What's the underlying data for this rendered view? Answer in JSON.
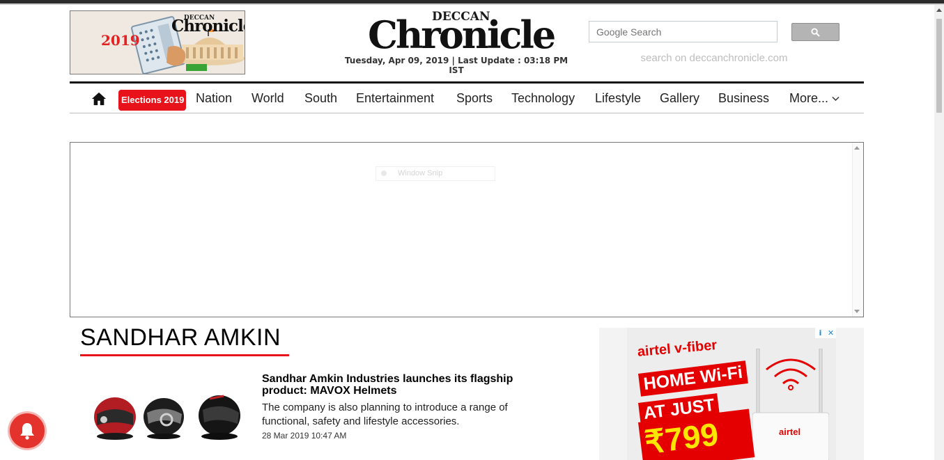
{
  "header": {
    "election_logo": {
      "year": "2019",
      "brand_small_top": "DECCAN",
      "brand_small": "Chronicle"
    },
    "brand": {
      "top": "DECCAN",
      "name": "Chronicle"
    },
    "dateline": "Tuesday, Apr 09, 2019 | Last Update : 03:18 PM IST",
    "search": {
      "placeholder": "Google Search",
      "hint": "search on deccanchronicle.com",
      "button_icon": "search-icon"
    }
  },
  "nav": {
    "home_icon": "home-icon",
    "highlight": "Elections 2019",
    "items": [
      "Nation",
      "World",
      "South",
      "Entertainment",
      "Sports",
      "Technology",
      "Lifestyle",
      "Gallery",
      "Business"
    ],
    "more": "More...",
    "accent": "#e8121b"
  },
  "ad_frame": {
    "snip_label": "Window Snip"
  },
  "section": {
    "title": "SANDHAR AMKIN"
  },
  "article": {
    "image_alt": "helmets",
    "title": "Sandhar Amkin Industries launches its flagship product: MAVOX Helmets",
    "summary": "The company is also planning to introduce a range of functional, safety and lifestyle accessories.",
    "date": "28 Mar 2019 10:47 AM"
  },
  "side_ad": {
    "brand": "airtel v-fiber",
    "line1": "HOME Wi-Fi",
    "line2": "AT JUST",
    "price": "₹799",
    "router_brand": "airtel",
    "badge_info": "i",
    "badge_close": "✕"
  },
  "notification_icon": "bell-icon"
}
